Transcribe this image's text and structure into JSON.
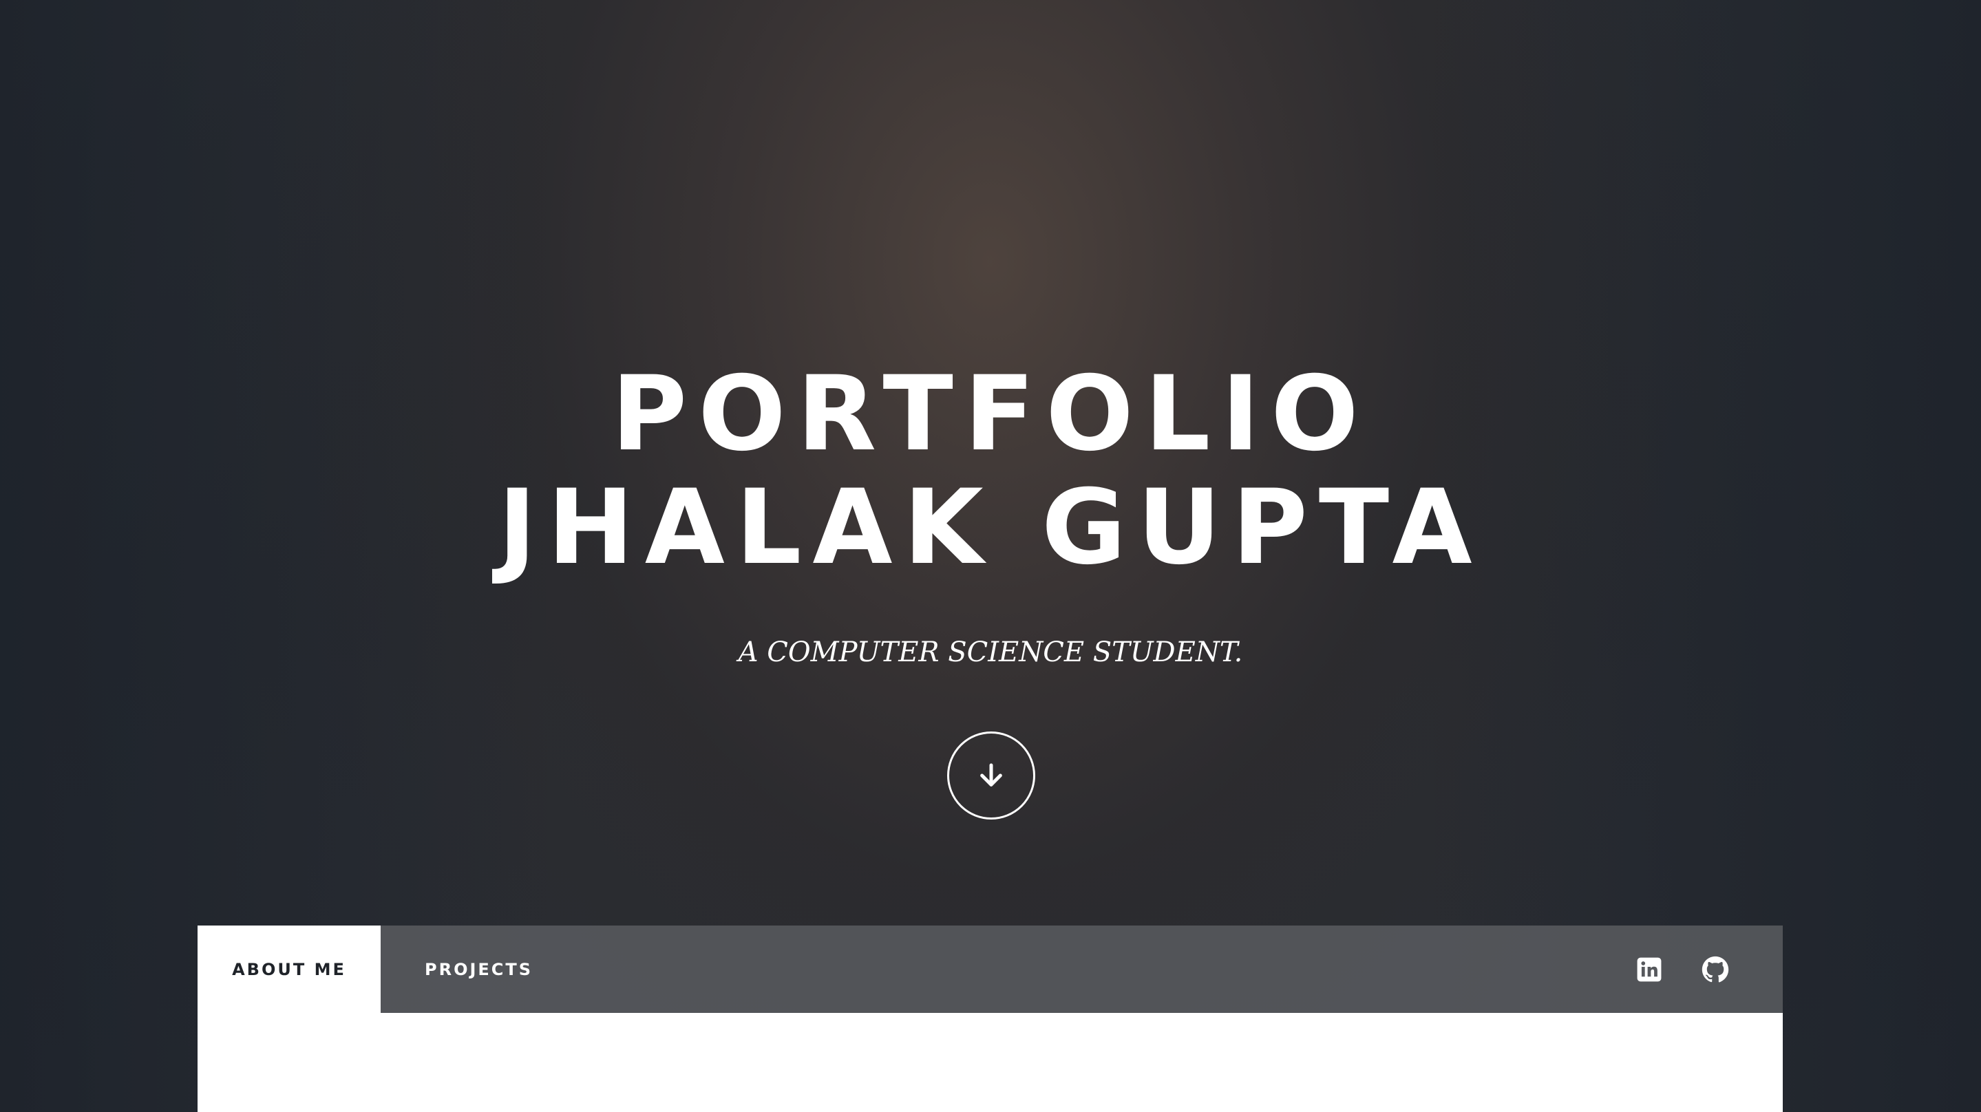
{
  "hero": {
    "title_line1": "PORTFOLIO",
    "title_line2": "JHALAK GUPTA",
    "subtitle": "A COMPUTER SCIENCE STUDENT.",
    "scroll_icon": "arrow-down-circle-icon"
  },
  "nav": {
    "tabs": [
      {
        "label": "ABOUT ME",
        "active": true
      },
      {
        "label": "PROJECTS",
        "active": false
      }
    ],
    "icons": [
      "linkedin-icon",
      "github-icon"
    ]
  },
  "colors": {
    "text": "#ffffff",
    "nav_bg": "#56585c",
    "active_tab_bg": "#ffffff",
    "active_tab_text": "#1f2329"
  }
}
